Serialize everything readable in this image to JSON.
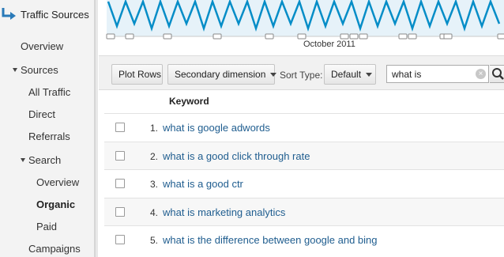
{
  "sidebar": {
    "title": "Traffic Sources",
    "items": {
      "overview": "Overview",
      "sources": "Sources",
      "all_traffic": "All Traffic",
      "direct": "Direct",
      "referrals": "Referrals",
      "search": "Search",
      "search_overview": "Overview",
      "organic": "Organic",
      "paid": "Paid",
      "campaigns": "Campaigns"
    }
  },
  "chart": {
    "axis_label": "October 2011",
    "line_color": "#058dc7",
    "fill_color": "#e6f2f9"
  },
  "toolbar": {
    "plot_rows": "Plot Rows",
    "secondary_dimension": "Secondary dimension",
    "sort_type_label": "Sort Type:",
    "sort_type_value": "Default",
    "search_value": "what is"
  },
  "table": {
    "column_header": "Keyword",
    "rows": [
      {
        "num": "1.",
        "keyword": "what is google adwords"
      },
      {
        "num": "2.",
        "keyword": "what is a good click through rate"
      },
      {
        "num": "3.",
        "keyword": "what is a good ctr"
      },
      {
        "num": "4.",
        "keyword": "what is marketing analytics"
      },
      {
        "num": "5.",
        "keyword": "what is the difference between google and bing"
      }
    ]
  }
}
